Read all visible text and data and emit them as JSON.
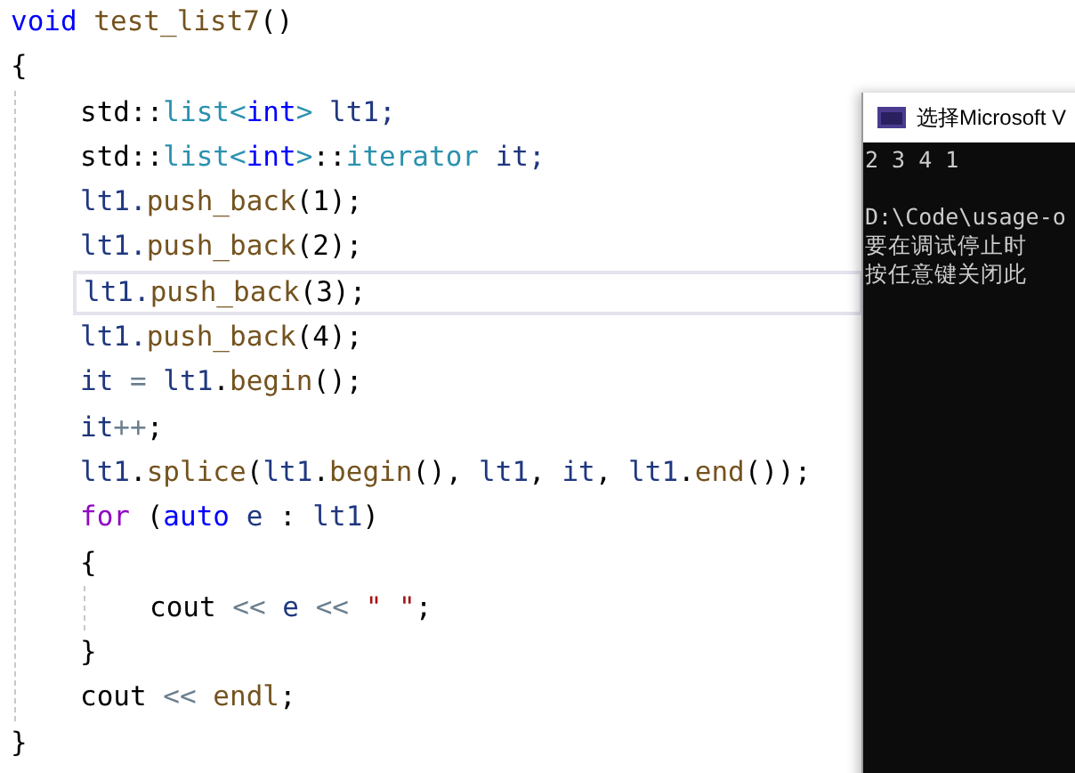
{
  "editor": {
    "lines": [
      {
        "current": false,
        "tokens": [
          {
            "text": "void ",
            "kind": "keyword"
          },
          {
            "text": "test_list7",
            "kind": "function"
          },
          {
            "text": "()",
            "kind": "plain"
          }
        ]
      },
      {
        "current": false,
        "tokens": [
          {
            "text": "{",
            "kind": "plain"
          }
        ],
        "children": [
          {
            "current": false,
            "tokens": [
              {
                "text": "std",
                "kind": "plain"
              },
              {
                "text": "::",
                "kind": "plain"
              },
              {
                "text": "list",
                "kind": "type"
              },
              {
                "text": "<",
                "kind": "type"
              },
              {
                "text": "int",
                "kind": "keyword"
              },
              {
                "text": ">",
                "kind": "type"
              },
              {
                "text": " lt1;",
                "kind": "variable"
              }
            ]
          },
          {
            "current": false,
            "tokens": [
              {
                "text": "std",
                "kind": "plain"
              },
              {
                "text": "::",
                "kind": "plain"
              },
              {
                "text": "list",
                "kind": "type"
              },
              {
                "text": "<",
                "kind": "type"
              },
              {
                "text": "int",
                "kind": "keyword"
              },
              {
                "text": ">",
                "kind": "type"
              },
              {
                "text": "::",
                "kind": "plain"
              },
              {
                "text": "iterator",
                "kind": "type"
              },
              {
                "text": " it;",
                "kind": "variable"
              }
            ]
          },
          {
            "current": false,
            "tokens": [
              {
                "text": "lt1.",
                "kind": "variable"
              },
              {
                "text": "push_back",
                "kind": "function"
              },
              {
                "text": "(1);",
                "kind": "plain"
              }
            ]
          },
          {
            "current": false,
            "tokens": [
              {
                "text": "lt1.",
                "kind": "variable"
              },
              {
                "text": "push_back",
                "kind": "function"
              },
              {
                "text": "(2);",
                "kind": "plain"
              }
            ]
          },
          {
            "current": true,
            "tokens": [
              {
                "text": "lt1.",
                "kind": "variable"
              },
              {
                "text": "push_back",
                "kind": "function"
              },
              {
                "text": "(3);",
                "kind": "plain"
              }
            ]
          },
          {
            "current": false,
            "tokens": [
              {
                "text": "lt1.",
                "kind": "variable"
              },
              {
                "text": "push_back",
                "kind": "function"
              },
              {
                "text": "(4);",
                "kind": "plain"
              }
            ]
          },
          {
            "current": false,
            "tokens": [
              {
                "text": "it",
                "kind": "variable"
              },
              {
                "text": " = ",
                "kind": "operator"
              },
              {
                "text": "lt1",
                "kind": "variable"
              },
              {
                "text": ".",
                "kind": "plain"
              },
              {
                "text": "begin",
                "kind": "function"
              },
              {
                "text": "();",
                "kind": "plain"
              }
            ]
          },
          {
            "current": false,
            "tokens": [
              {
                "text": "it",
                "kind": "variable"
              },
              {
                "text": "++",
                "kind": "operator"
              },
              {
                "text": ";",
                "kind": "plain"
              }
            ]
          },
          {
            "current": false,
            "tokens": [
              {
                "text": "lt1",
                "kind": "variable"
              },
              {
                "text": ".",
                "kind": "plain"
              },
              {
                "text": "splice",
                "kind": "function"
              },
              {
                "text": "(",
                "kind": "plain"
              },
              {
                "text": "lt1",
                "kind": "variable"
              },
              {
                "text": ".",
                "kind": "plain"
              },
              {
                "text": "begin",
                "kind": "function"
              },
              {
                "text": "(), ",
                "kind": "plain"
              },
              {
                "text": "lt1",
                "kind": "variable"
              },
              {
                "text": ", ",
                "kind": "plain"
              },
              {
                "text": "it",
                "kind": "variable"
              },
              {
                "text": ", ",
                "kind": "plain"
              },
              {
                "text": "lt1",
                "kind": "variable"
              },
              {
                "text": ".",
                "kind": "plain"
              },
              {
                "text": "end",
                "kind": "function"
              },
              {
                "text": "());",
                "kind": "plain"
              }
            ]
          },
          {
            "current": false,
            "tokens": [
              {
                "text": "for",
                "kind": "control"
              },
              {
                "text": " (",
                "kind": "plain"
              },
              {
                "text": "auto",
                "kind": "keyword"
              },
              {
                "text": " e",
                "kind": "variable"
              },
              {
                "text": " : ",
                "kind": "plain"
              },
              {
                "text": "lt1",
                "kind": "variable"
              },
              {
                "text": ")",
                "kind": "plain"
              }
            ]
          },
          {
            "current": false,
            "tokens": [
              {
                "text": "{",
                "kind": "plain"
              }
            ],
            "children": [
              {
                "current": false,
                "tokens": [
                  {
                    "text": "cout",
                    "kind": "plain"
                  },
                  {
                    "text": " << ",
                    "kind": "operator"
                  },
                  {
                    "text": "e",
                    "kind": "variable"
                  },
                  {
                    "text": " << ",
                    "kind": "operator"
                  },
                  {
                    "text": "\" \"",
                    "kind": "string"
                  },
                  {
                    "text": ";",
                    "kind": "plain"
                  }
                ]
              }
            ]
          },
          {
            "current": false,
            "tokens": [
              {
                "text": "}",
                "kind": "plain"
              }
            ]
          },
          {
            "current": false,
            "tokens": [
              {
                "text": "cout",
                "kind": "plain"
              },
              {
                "text": " << ",
                "kind": "operator"
              },
              {
                "text": "endl",
                "kind": "function"
              },
              {
                "text": ";",
                "kind": "plain"
              }
            ]
          }
        ]
      },
      {
        "current": false,
        "tokens": [
          {
            "text": "}",
            "kind": "plain"
          }
        ]
      }
    ]
  },
  "console": {
    "title": "选择Microsoft V",
    "lines": [
      "2 3 4 1",
      "D:\\Code\\usage-o",
      "要在调试停止时",
      "按任意键关闭此"
    ]
  }
}
